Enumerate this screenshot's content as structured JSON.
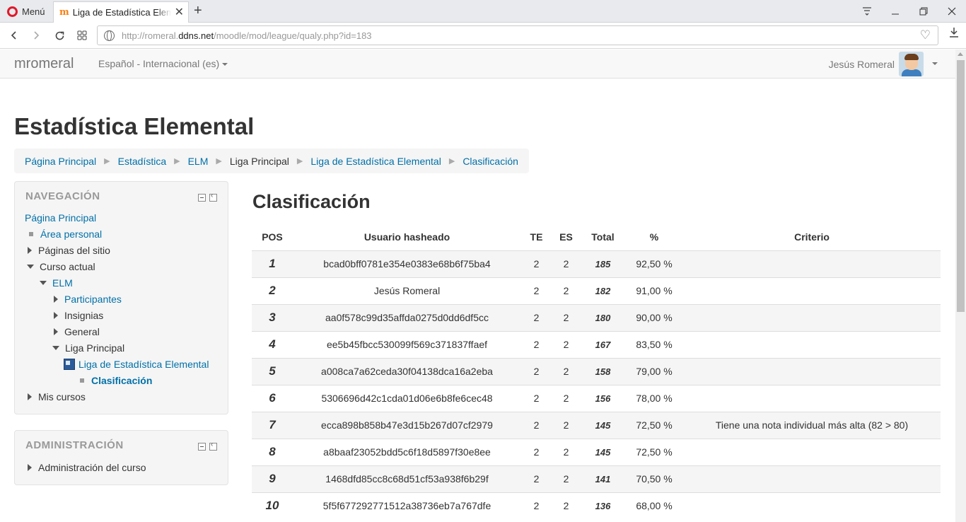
{
  "browser": {
    "menu_label": "Menú",
    "tab_title": "Liga de Estadística Elemental",
    "url_prefix": "http://romeral.",
    "url_host": "ddns.net",
    "url_path": "/moodle/mod/league/qualy.php?id=183"
  },
  "navbar": {
    "brand": "mromeral",
    "language": "Español - Internacional (es)",
    "user_name": "Jesús Romeral"
  },
  "page": {
    "title": "Estadística Elemental",
    "breadcrumb": [
      "Página Principal",
      "Estadística",
      "ELM",
      "Liga Principal",
      "Liga de Estadística Elemental",
      "Clasificación"
    ]
  },
  "navigation": {
    "title": "NAVEGACIÓN",
    "items": [
      "Página Principal",
      "Área personal",
      "Páginas del sitio",
      "Curso actual",
      "ELM",
      "Participantes",
      "Insignias",
      "General",
      "Liga Principal",
      "Liga de Estadística Elemental",
      "Clasificación",
      "Mis cursos"
    ]
  },
  "administration": {
    "title": "ADMINISTRACIÓN",
    "items": [
      "Administración del curso"
    ]
  },
  "main": {
    "title": "Clasificación",
    "columns": [
      "POS",
      "Usuario hasheado",
      "TE",
      "ES",
      "Total",
      "%",
      "Criterio"
    ],
    "rows": [
      {
        "pos": "1",
        "user": "bcad0bff0781e354e0383e68b6f75ba4",
        "te": "2",
        "es": "2",
        "total": "185",
        "pct": "92,50 %",
        "criterio": ""
      },
      {
        "pos": "2",
        "user": "Jesús Romeral",
        "te": "2",
        "es": "2",
        "total": "182",
        "pct": "91,00 %",
        "criterio": ""
      },
      {
        "pos": "3",
        "user": "aa0f578c99d35affda0275d0dd6df5cc",
        "te": "2",
        "es": "2",
        "total": "180",
        "pct": "90,00 %",
        "criterio": ""
      },
      {
        "pos": "4",
        "user": "ee5b45fbcc530099f569c371837ffaef",
        "te": "2",
        "es": "2",
        "total": "167",
        "pct": "83,50 %",
        "criterio": ""
      },
      {
        "pos": "5",
        "user": "a008ca7a62ceda30f04138dca16a2eba",
        "te": "2",
        "es": "2",
        "total": "158",
        "pct": "79,00 %",
        "criterio": ""
      },
      {
        "pos": "6",
        "user": "5306696d42c1cda01d06e6b8fe6cec48",
        "te": "2",
        "es": "2",
        "total": "156",
        "pct": "78,00 %",
        "criterio": ""
      },
      {
        "pos": "7",
        "user": "ecca898b858b47e3d15b267d07cf2979",
        "te": "2",
        "es": "2",
        "total": "145",
        "pct": "72,50 %",
        "criterio": "Tiene una nota individual más alta (82 > 80)"
      },
      {
        "pos": "8",
        "user": "a8baaf23052bdd5c6f18d5897f30e8ee",
        "te": "2",
        "es": "2",
        "total": "145",
        "pct": "72,50 %",
        "criterio": ""
      },
      {
        "pos": "9",
        "user": "1468dfd85cc8c68d51cf53a938f6b29f",
        "te": "2",
        "es": "2",
        "total": "141",
        "pct": "70,50 %",
        "criterio": ""
      },
      {
        "pos": "10",
        "user": "5f5f677292771512a38736eb7a767dfe",
        "te": "2",
        "es": "2",
        "total": "136",
        "pct": "68,00 %",
        "criterio": ""
      }
    ]
  },
  "colors": {
    "link": "#0070a8",
    "block_bg": "#f5f5f5",
    "opera_red": "#e0192a"
  }
}
